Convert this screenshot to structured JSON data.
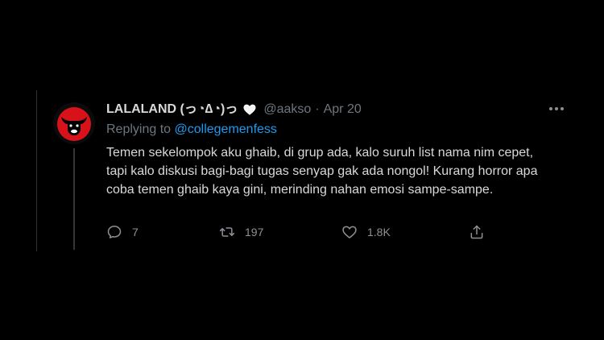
{
  "tweet": {
    "display_name": "LALALAND (っ◔∆◔)っ",
    "name_emoji": "white-heart",
    "handle": "@aakso",
    "separator": "·",
    "date": "Apr 20",
    "replying_prefix": "Replying to",
    "replying_mention": "@collegemenfess",
    "text": "Temen sekelompok aku ghaib, di grup ada, kalo suruh list nama nim cepet, tapi kalo diskusi bagi-bagi tugas senyap gak ada nongol! Kurang horror apa coba temen ghaib kaya gini, merinding nahan emosi sampe-sampe.",
    "avatar_colors": {
      "background": "#d8121b",
      "figure": "#000000"
    }
  },
  "actions": {
    "reply_count": "7",
    "retweet_count": "197",
    "like_count": "1.8K",
    "icons": [
      "reply-icon",
      "retweet-icon",
      "like-icon",
      "share-icon"
    ]
  },
  "colors": {
    "background": "#000000",
    "text": "#d9d9d9",
    "muted": "#6e767d",
    "link": "#1d9bf0"
  }
}
